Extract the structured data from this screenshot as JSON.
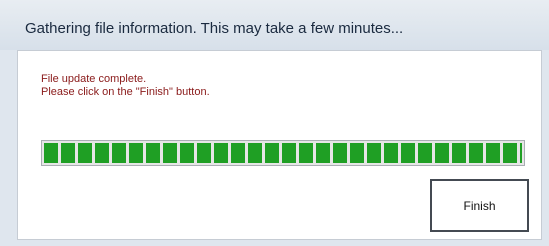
{
  "dialog": {
    "status_text": "Gathering file information. This may take a few minutes...",
    "message_lines": [
      "File update complete.",
      "Please click on the \"Finish\" button."
    ],
    "progress_percent": 100,
    "finish_label": "Finish"
  },
  "colors": {
    "progress_fill": "#1f9f24",
    "message_text": "#8a1a1a"
  }
}
